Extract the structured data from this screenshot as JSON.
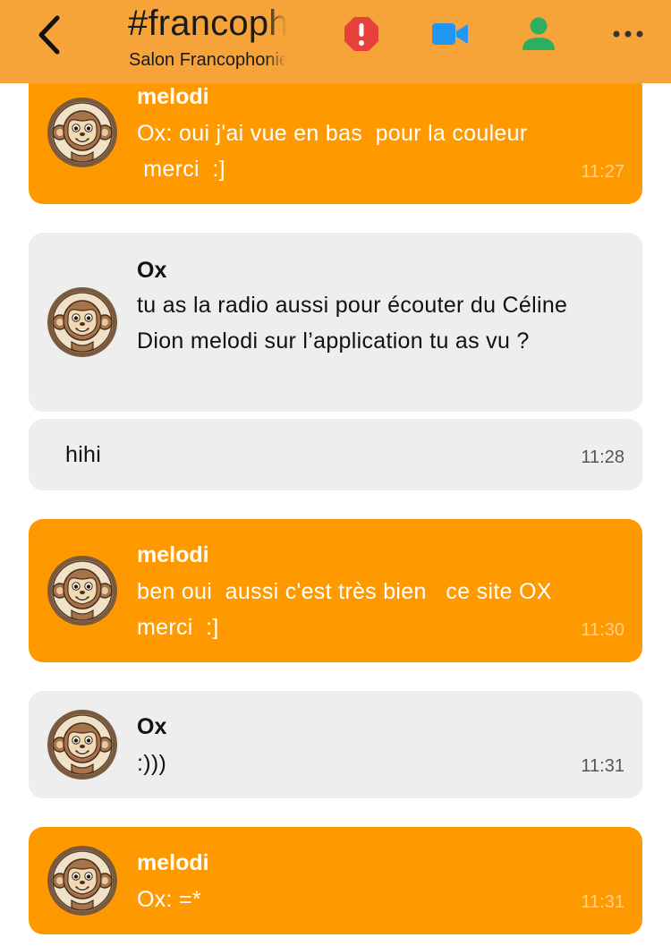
{
  "header": {
    "title": "#francophonie",
    "subtitle": "Salon Francophonie",
    "bg_color": "#f6a43a",
    "icons": {
      "back": "chevron-left-icon",
      "alert": "alert-octagon-icon",
      "video": "video-camera-icon",
      "person": "person-icon",
      "more": "more-dots-icon"
    }
  },
  "colors": {
    "own_bubble": "#fe9900",
    "other_bubble": "#eeeeee",
    "alert_red": "#e8413b",
    "video_blue": "#2196f3",
    "person_green": "#2eae5f"
  },
  "messages": [
    {
      "sender": "melodi",
      "text": "Ox: oui j'ai vue en bas  pour la couleur\n merci  :]",
      "time": "11:27"
    },
    {
      "sender": "Ox",
      "text": "tu as la radio aussi pour écouter du Céline Dion melodi sur l’application tu as vu ?",
      "time": ""
    },
    {
      "sender": "",
      "text": "hihi",
      "time": "11:28"
    },
    {
      "sender": "melodi",
      "text": "ben oui  aussi c'est très bien   ce site OX   merci  :]",
      "time": "11:30"
    },
    {
      "sender": "Ox",
      "text": ":)))",
      "time": "11:31"
    },
    {
      "sender": "melodi",
      "text": "Ox: =*",
      "time": "11:31"
    }
  ]
}
